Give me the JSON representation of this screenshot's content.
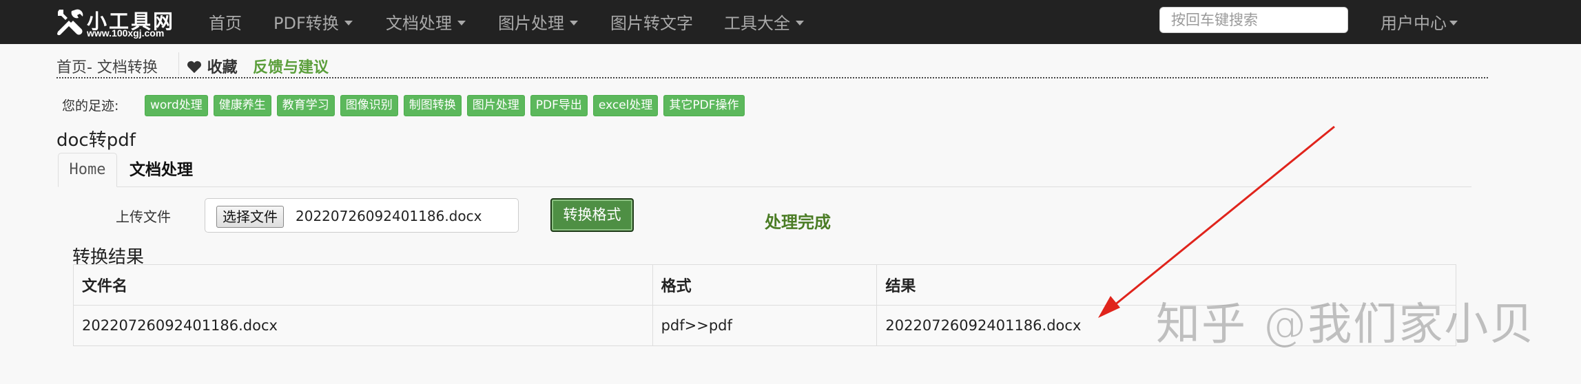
{
  "navbar": {
    "logo_title": "小工具网",
    "logo_subtitle": "www.100xgj.com",
    "items": [
      {
        "label": "首页",
        "dropdown": false
      },
      {
        "label": "PDF转换",
        "dropdown": true
      },
      {
        "label": "文档处理",
        "dropdown": true
      },
      {
        "label": "图片处理",
        "dropdown": true
      },
      {
        "label": "图片转文字",
        "dropdown": false
      },
      {
        "label": "工具大全",
        "dropdown": true
      }
    ],
    "search_placeholder": "按回车键搜索",
    "user_center": "用户中心"
  },
  "breadcrumb": {
    "path": "首页- 文档转换",
    "favorite": "收藏",
    "feedback": "反馈与建议"
  },
  "footprint": {
    "label": "您的足迹:",
    "tags": [
      "word处理",
      "健康养生",
      "教育学习",
      "图像识别",
      "制图转换",
      "图片处理",
      "PDF导出",
      "excel处理",
      "其它PDF操作"
    ]
  },
  "page_title": "doc转pdf",
  "tabs": [
    "Home",
    "文档处理"
  ],
  "upload": {
    "label": "上传文件",
    "choose_button": "选择文件",
    "file_name": "20220726092401186.docx",
    "convert_button": "转换格式",
    "status": "处理完成"
  },
  "result": {
    "title": "转换结果",
    "headers": [
      "文件名",
      "格式",
      "结果"
    ],
    "rows": [
      [
        "20220726092401186.docx",
        "pdf>>pdf",
        "20220726092401186.docx"
      ]
    ]
  },
  "watermark": "知乎 @我们家小贝",
  "colors": {
    "navbar_bg": "#222222",
    "accent_green": "#5cb85c",
    "status_green": "#4a7c24",
    "arrow_red": "#e0241c"
  }
}
